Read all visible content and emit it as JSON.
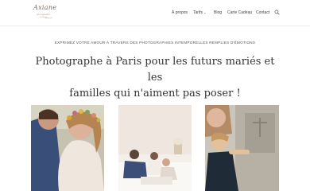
{
  "header": {
    "logo": {
      "name": "Axiane",
      "sub": "photographe"
    },
    "nav": [
      {
        "label": "À propos"
      },
      {
        "label": "Tarifs",
        "has_dropdown": true
      },
      {
        "label": "Blog"
      },
      {
        "label": "Carte Cadeau"
      },
      {
        "label": "Contact"
      }
    ],
    "search_icon": "search-icon"
  },
  "hero": {
    "tagline": "EXPRIMEZ VOTRE AMOUR À TRAVERS DES PHOTOGRAPHIES INTEMPORELLES REMPLIES D'ÉMOTIONS",
    "headline_line1": "Photographe à Paris pour les futurs mariés et les",
    "headline_line2": "familles qui n'aiment pas poser !"
  },
  "gallery": [
    {
      "subject": "wedding couple with flower crown"
    },
    {
      "subject": "family with baby on bed"
    },
    {
      "subject": "mother and child at church door"
    }
  ]
}
